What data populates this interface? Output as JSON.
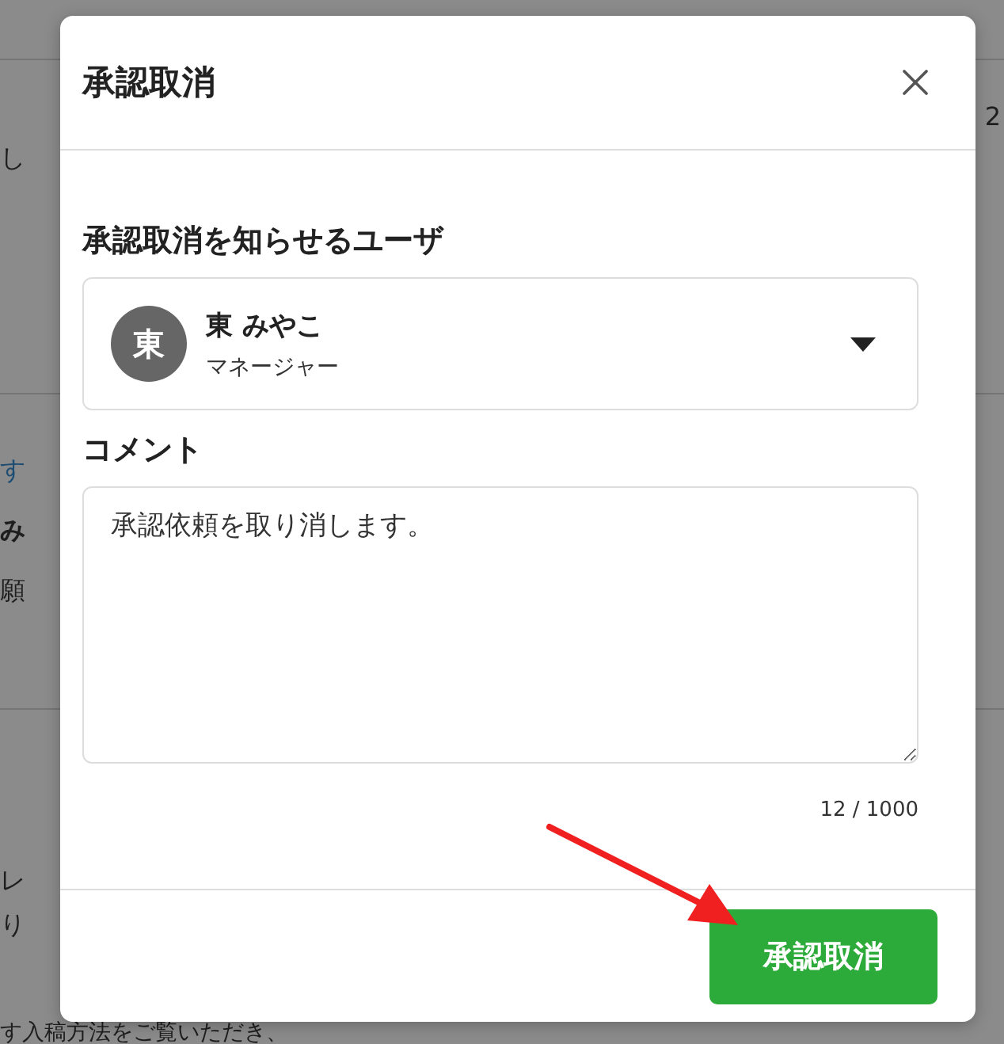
{
  "background": {
    "sections": [
      {
        "left": [
          {
            "text": "し",
            "kind": "plain"
          }
        ],
        "right": [
          {
            "text": "2",
            "kind": "plain"
          }
        ]
      },
      {
        "left": [
          {
            "text": "す",
            "kind": "link"
          },
          {
            "text": "み",
            "kind": "bold"
          },
          {
            "text": "願",
            "kind": "plain"
          }
        ]
      },
      {
        "left": [
          {
            "text": "レ",
            "kind": "plain"
          },
          {
            "text": "り",
            "kind": "plain"
          }
        ]
      },
      {
        "left": [
          {
            "text": "す入稿方法をご覧いただき、",
            "kind": "plain"
          }
        ]
      }
    ]
  },
  "dialog": {
    "title": "承認取消",
    "user_field": {
      "label": "承認取消を知らせるユーザ",
      "avatar": "東",
      "name": "東 みやこ",
      "role": "マネージャー"
    },
    "comment": {
      "label": "コメント",
      "value": "承認依頼を取り消します。",
      "counter": "12 / 1000"
    },
    "button": "承認取消"
  }
}
